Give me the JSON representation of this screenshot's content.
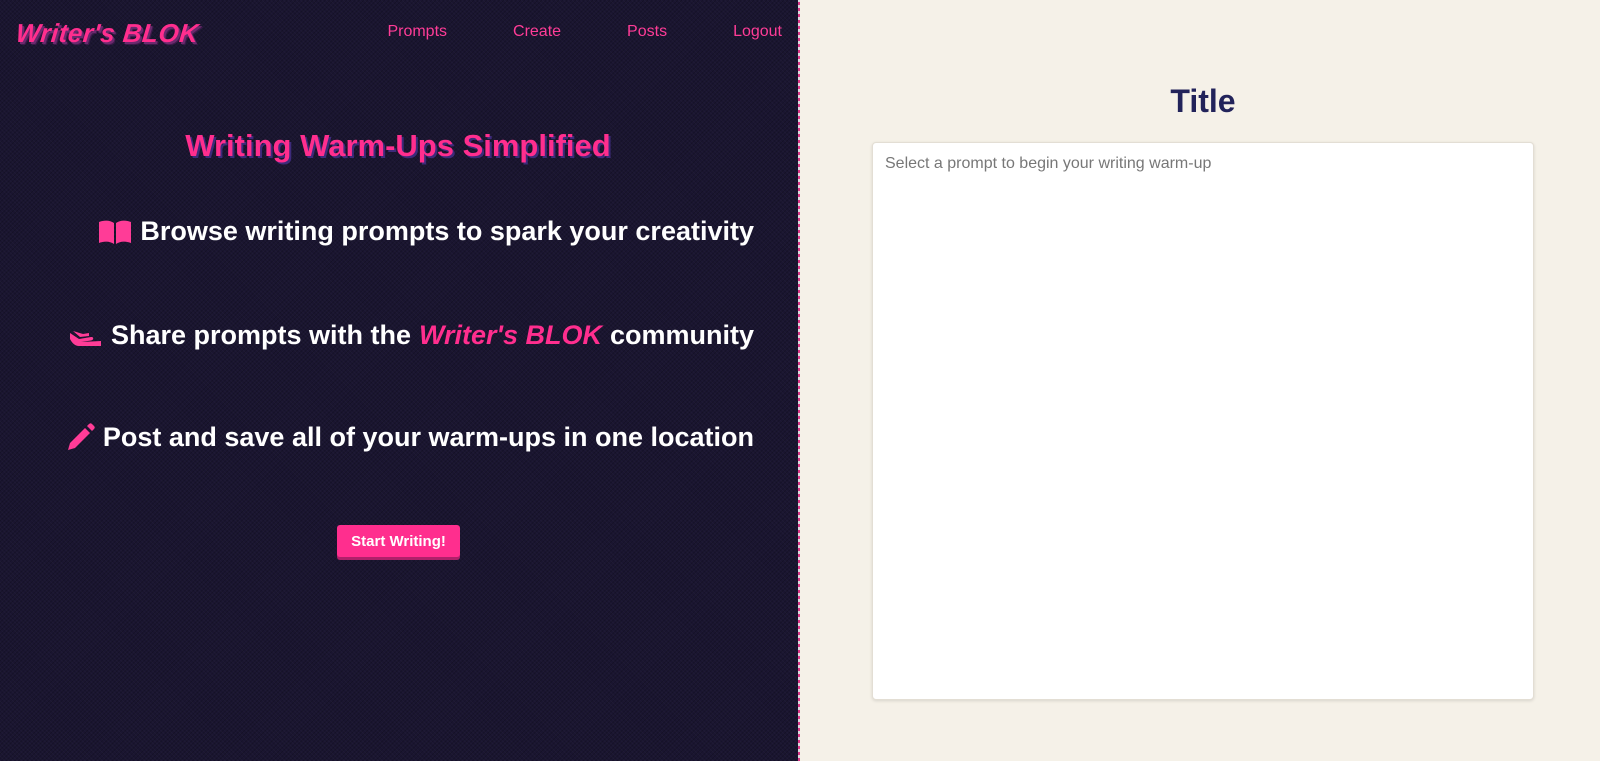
{
  "header": {
    "logo": "Writer's BLOK",
    "nav": [
      "Prompts",
      "Create",
      "Posts",
      "Logout"
    ]
  },
  "hero": {
    "title": "Writing Warm-Ups Simplified",
    "features": [
      {
        "icon": "book-open-icon",
        "text": "Browse writing prompts to spark your creativity"
      },
      {
        "icon": "hand-holding-icon",
        "text_before": "Share prompts with the",
        "brand": "Writer's BLOK",
        "text_after": "community"
      },
      {
        "icon": "pencil-icon",
        "text": "Post and save all of your warm-ups in one location"
      }
    ],
    "cta_label": "Start Writing!"
  },
  "editor": {
    "title": "Title",
    "placeholder": "Select a prompt to begin your writing warm-up"
  },
  "colors": {
    "accent": "#ff2e8e",
    "left_bg": "#1a1530",
    "right_bg": "#f5f1e8",
    "title_color": "#22235a"
  }
}
